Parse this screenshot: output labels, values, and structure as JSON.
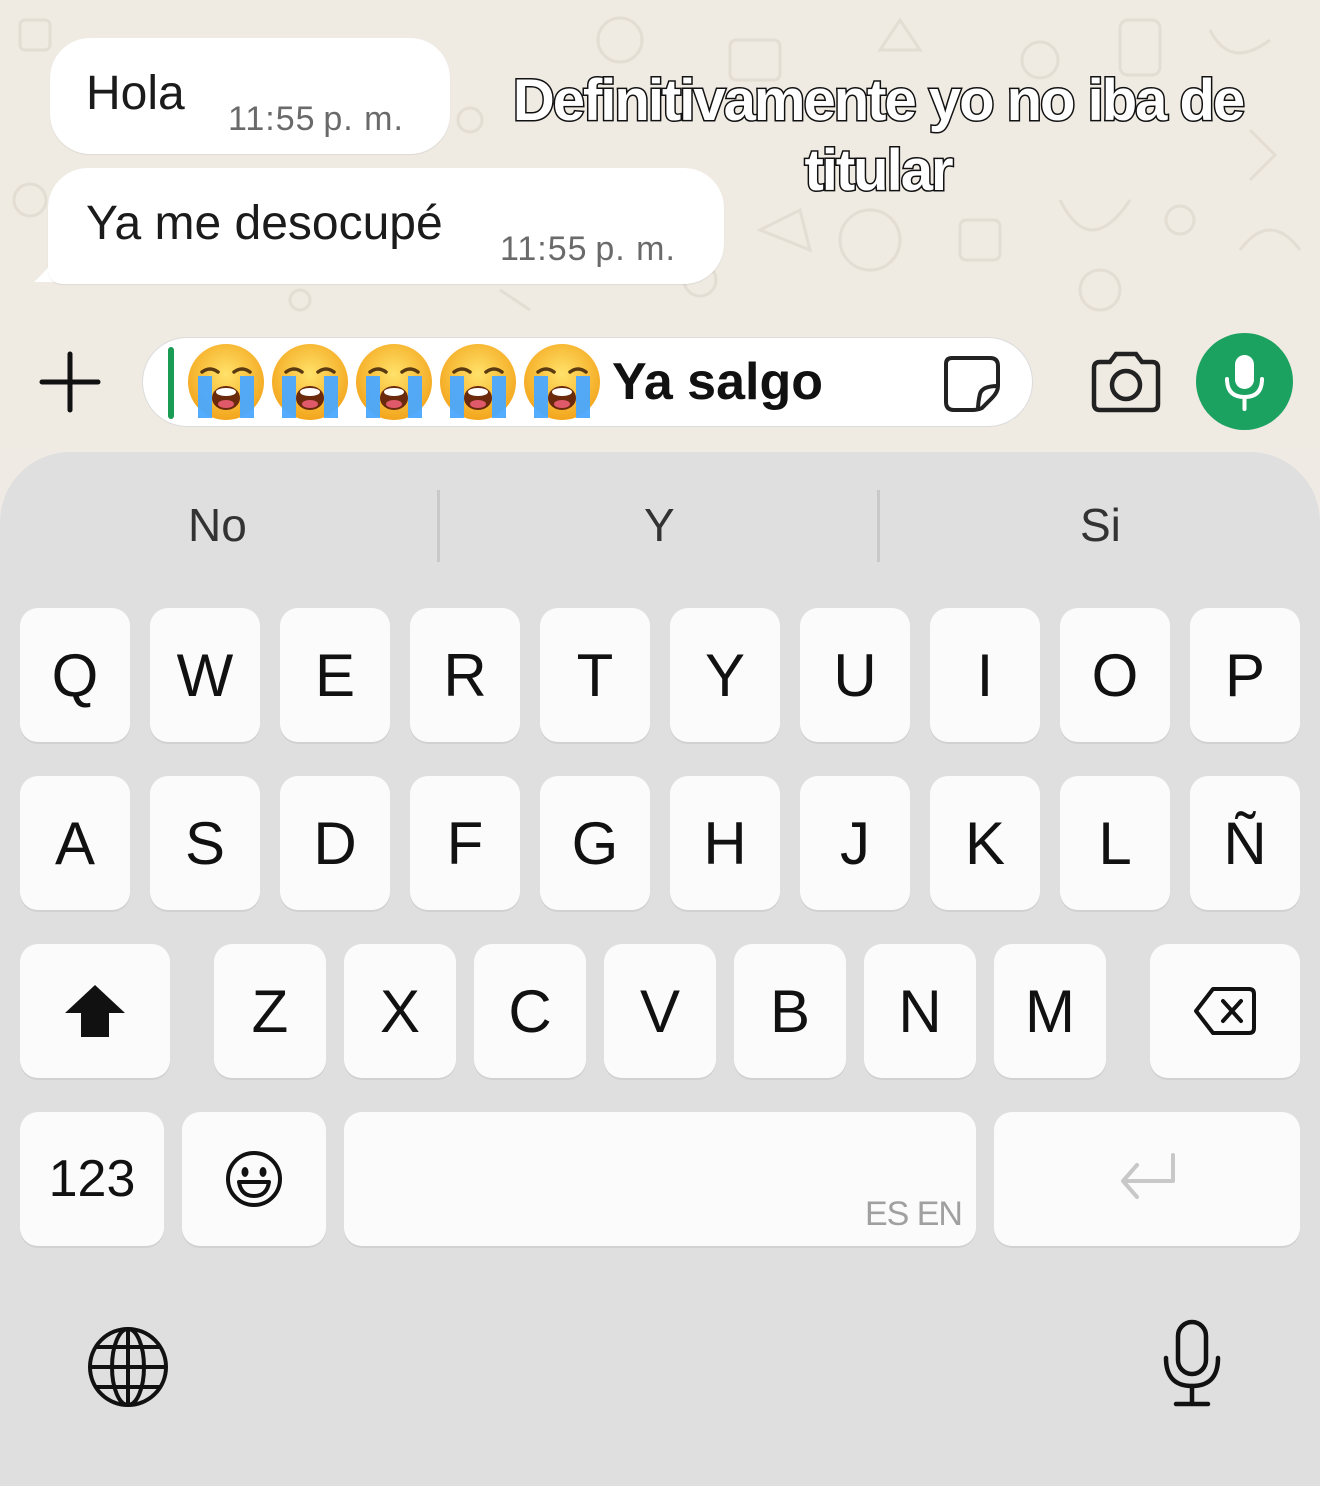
{
  "chat": {
    "messages": [
      {
        "text": "Hola",
        "time": "11:55 p. m."
      },
      {
        "text": "Ya me desocupé",
        "time": "11:55 p. m."
      }
    ],
    "overlay_caption": "Definitivamente yo no iba de titular"
  },
  "composer": {
    "emojis": [
      "loudly-crying-face",
      "loudly-crying-face",
      "loudly-crying-face",
      "loudly-crying-face",
      "loudly-crying-face"
    ],
    "typed_text": "Ya salgo",
    "accent_color": "#1ba160"
  },
  "keyboard": {
    "suggestions": [
      "No",
      "Y",
      "Si"
    ],
    "row1": [
      "Q",
      "W",
      "E",
      "R",
      "T",
      "Y",
      "U",
      "I",
      "O",
      "P"
    ],
    "row2": [
      "A",
      "S",
      "D",
      "F",
      "G",
      "H",
      "J",
      "K",
      "L",
      "Ñ"
    ],
    "row3": [
      "Z",
      "X",
      "C",
      "V",
      "B",
      "N",
      "M"
    ],
    "numbers_label": "123",
    "space_languages": "ES EN"
  }
}
